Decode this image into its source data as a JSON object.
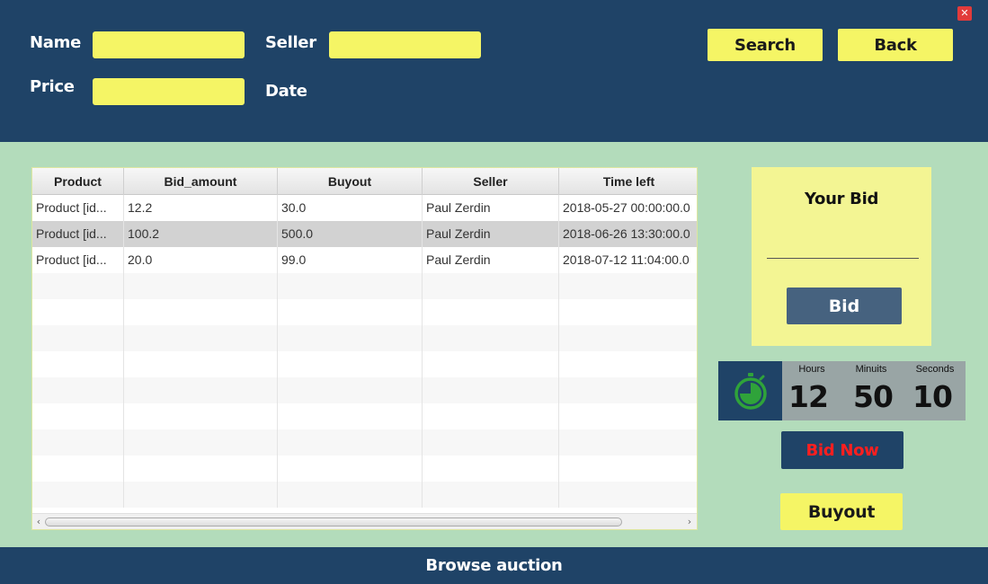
{
  "header": {
    "name_label": "Name",
    "seller_label": "Seller",
    "price_label": "Price",
    "date_label": "Date",
    "name_value": "",
    "seller_value": "",
    "price_value": "",
    "search_label": "Search",
    "back_label": "Back",
    "close_glyph": "✕"
  },
  "table": {
    "columns": [
      "Product",
      "Bid_amount",
      "Buyout",
      "Seller",
      "Time left"
    ],
    "rows": [
      [
        "Product [id...",
        "12.2",
        "30.0",
        "Paul Zerdin",
        "2018-05-27 00:00:00.0"
      ],
      [
        "Product [id...",
        "100.2",
        "500.0",
        "Paul Zerdin",
        "2018-06-26 13:30:00.0"
      ],
      [
        "Product [id...",
        "20.0",
        "99.0",
        "Paul Zerdin",
        "2018-07-12 11:04:00.0"
      ]
    ],
    "selected_row": 1,
    "scroll_left_glyph": "‹",
    "scroll_right_glyph": "›"
  },
  "bid_panel": {
    "title": "Your Bid",
    "bid_value": "",
    "bid_button_label": "Bid"
  },
  "timer": {
    "icon": "stopwatch-icon",
    "hours_label": "Hours",
    "minutes_label": "Minuits",
    "seconds_label": "Seconds",
    "hours": "12",
    "minutes": "50",
    "seconds": "10"
  },
  "actions": {
    "bid_now_label": "Bid Now",
    "buyout_label": "Buyout"
  },
  "footer": {
    "title": "Browse auction"
  },
  "colors": {
    "navy": "#1f4367",
    "mint": "#b3dcbb",
    "yellow": "#f5f565",
    "pale_yellow": "#f3f593",
    "bid_button": "#46627f",
    "timer_gray": "#99a5a5",
    "timer_green": "#2fa33a",
    "bid_now_text": "#ff1f1f",
    "selected_row": "#d2d2d2"
  }
}
